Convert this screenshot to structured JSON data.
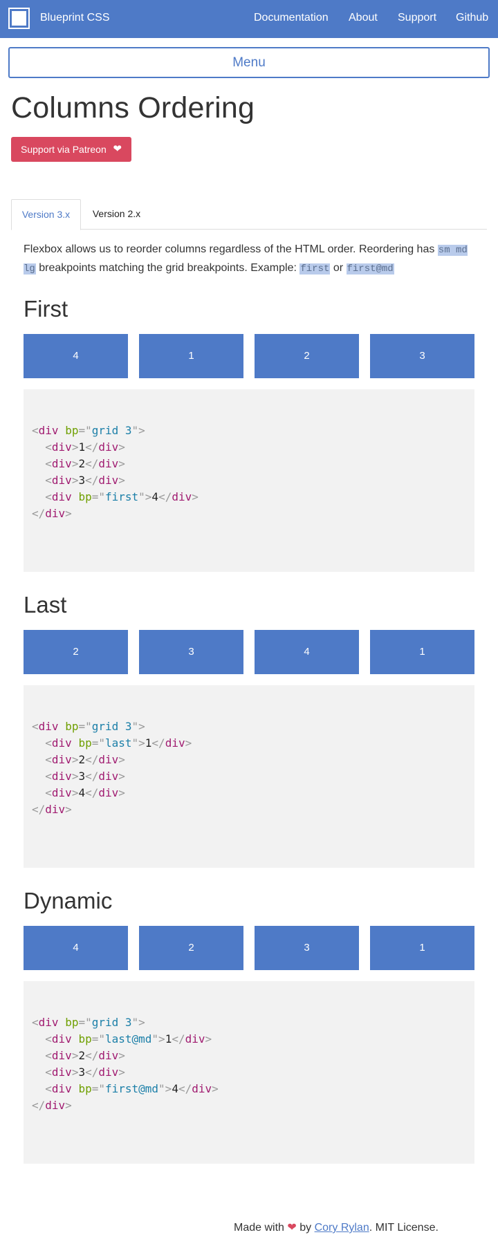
{
  "header": {
    "brand": "Blueprint CSS",
    "nav": [
      "Documentation",
      "About",
      "Support",
      "Github"
    ]
  },
  "menu_label": "Menu",
  "page_title": "Columns Ordering",
  "patreon_label": "Support via Patreon",
  "tabs": [
    {
      "label": "Version 3.x",
      "active": true
    },
    {
      "label": "Version 2.x",
      "active": false
    }
  ],
  "intro": {
    "text1": "Flexbox allows us to reorder columns regardless of the HTML order. Reordering has ",
    "code1": "sm md lg",
    "text2": " breakpoints matching the grid breakpoints. Example: ",
    "code2": "first",
    "text3": " or ",
    "code3": "first@md"
  },
  "sections": [
    {
      "title": "First",
      "columns": [
        "4",
        "1",
        "2",
        "3"
      ],
      "code": {
        "grid_attr": "bp",
        "grid_val": "grid 3",
        "lines": [
          {
            "attr": "",
            "val": "",
            "content": "1"
          },
          {
            "attr": "",
            "val": "",
            "content": "2"
          },
          {
            "attr": "",
            "val": "",
            "content": "3"
          },
          {
            "attr": "bp",
            "val": "first",
            "content": "4"
          }
        ]
      }
    },
    {
      "title": "Last",
      "columns": [
        "2",
        "3",
        "4",
        "1"
      ],
      "code": {
        "grid_attr": "bp",
        "grid_val": "grid 3",
        "lines": [
          {
            "attr": "bp",
            "val": "last",
            "content": "1"
          },
          {
            "attr": "",
            "val": "",
            "content": "2"
          },
          {
            "attr": "",
            "val": "",
            "content": "3"
          },
          {
            "attr": "",
            "val": "",
            "content": "4"
          }
        ]
      }
    },
    {
      "title": "Dynamic",
      "columns": [
        "4",
        "2",
        "3",
        "1"
      ],
      "code": {
        "grid_attr": "bp",
        "grid_val": "grid 3",
        "lines": [
          {
            "attr": "bp",
            "val": "last@md",
            "content": "1"
          },
          {
            "attr": "",
            "val": "",
            "content": "2"
          },
          {
            "attr": "",
            "val": "",
            "content": "3"
          },
          {
            "attr": "bp",
            "val": "first@md",
            "content": "4"
          }
        ]
      }
    }
  ],
  "footer": {
    "made_with": "Made with",
    "by": "by",
    "author": "Cory Rylan",
    "license": ". MIT License."
  },
  "colors": {
    "primary": "#4e7ac7",
    "patreon": "#d9485f",
    "code_bg": "#f2f2f2",
    "tag": "#a01b70",
    "attr": "#6f9f00",
    "value": "#1b7fa8"
  },
  "icons": {
    "logo": "square-logo-icon",
    "patreon_heart": "heart-icon",
    "footer_heart": "heart-icon"
  }
}
